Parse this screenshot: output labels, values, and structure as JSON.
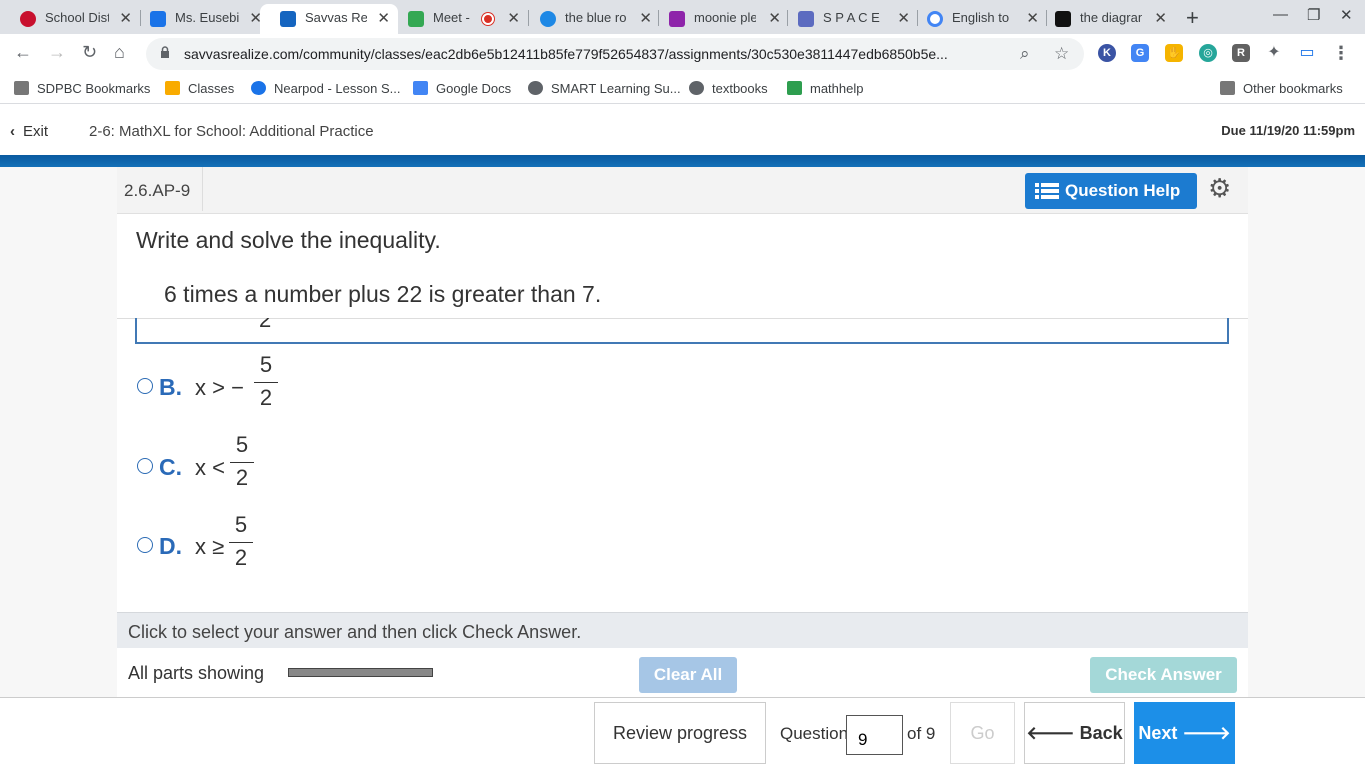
{
  "browser": {
    "tabs": [
      {
        "title": "School Dist",
        "color": "#c8102e"
      },
      {
        "title": "Ms. Eusebi",
        "color": "#1a73e8"
      },
      {
        "title": "Savvas Re",
        "color": "#1565c0"
      },
      {
        "title": "Meet -",
        "color": "#34a853"
      },
      {
        "title": "the blue ro",
        "color": "#1e88e5"
      },
      {
        "title": "moonie ple",
        "color": "#8e24aa"
      },
      {
        "title": "S P A C E",
        "color": "#5c6bc0"
      },
      {
        "title": "English to",
        "color": "#4285f4"
      },
      {
        "title": "the diagran",
        "color": "#111111"
      }
    ],
    "url": "savvasrealize.com/community/classes/eac2db6e5b12411b85fe779f52654837/assignments/30c530e3811447edb6850b5e...",
    "bookmarks": [
      "SDPBC Bookmarks",
      "Classes",
      "Nearpod - Lesson S...",
      "Google Docs",
      "SMART Learning Su...",
      "textbooks",
      "mathhelp"
    ],
    "other_bookmarks": "Other bookmarks"
  },
  "header": {
    "exit_label": "Exit",
    "assignment_title": "2-6: MathXL for School: Additional Practice",
    "due": "Due 11/19/20 11:59pm"
  },
  "question": {
    "id": "2.6.AP-9",
    "help_label": "Question Help",
    "prompt": "Write and solve the inequality.",
    "problem": "6 times a number plus 22 is greater than 7.",
    "option_a_fragment": "2",
    "options": [
      {
        "letter": "B.",
        "lhs": "x > −",
        "num": "5",
        "den": "2"
      },
      {
        "letter": "C.",
        "lhs": "x <",
        "num": "5",
        "den": "2"
      },
      {
        "letter": "D.",
        "lhs": "x ≥",
        "num": "5",
        "den": "2"
      }
    ],
    "instruction": "Click to select your answer and then click Check Answer.",
    "parts_label": "All parts showing",
    "progress_fraction": 1.0,
    "clear_all": "Clear All",
    "check_answer": "Check Answer"
  },
  "footer": {
    "review": "Review progress",
    "question_label": "Question",
    "question_value": "9",
    "of_total": "of 9",
    "go": "Go",
    "back": "Back",
    "next": "Next"
  }
}
